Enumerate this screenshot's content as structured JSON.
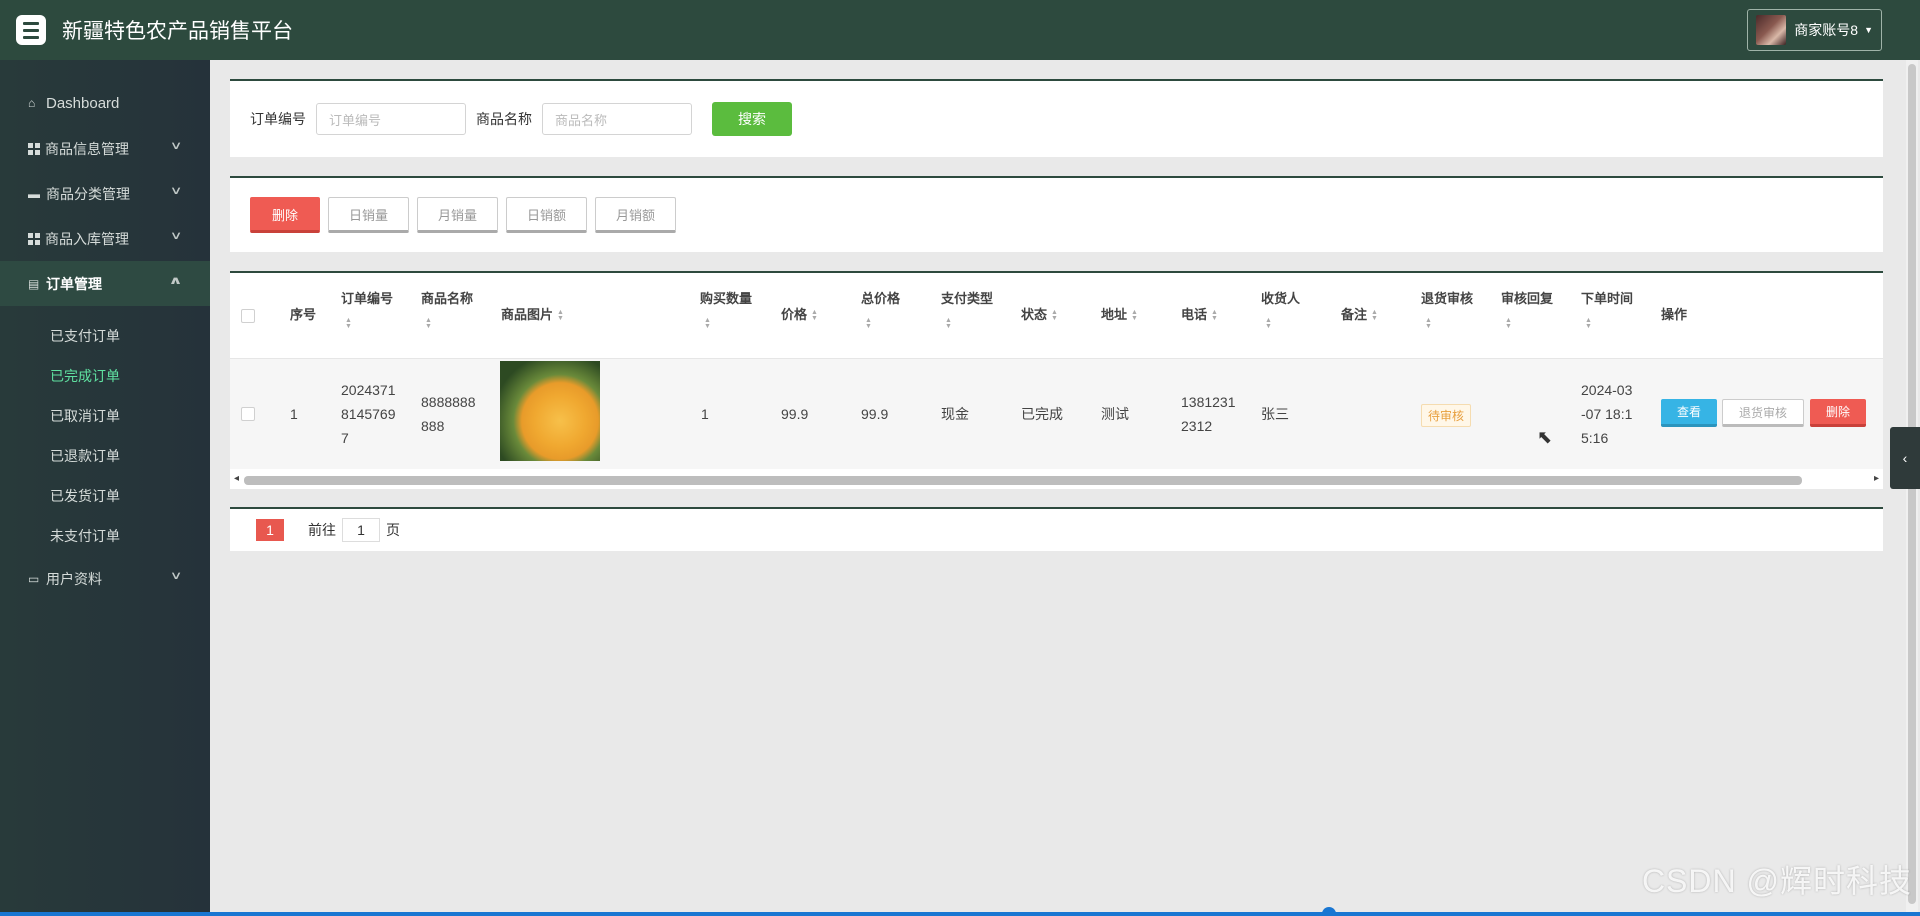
{
  "header": {
    "title": "新疆特色农产品销售平台",
    "account": "商家账号8"
  },
  "sidebar": {
    "items": [
      {
        "label": "Dashboard"
      },
      {
        "label": "商品信息管理"
      },
      {
        "label": "商品分类管理"
      },
      {
        "label": "商品入库管理"
      },
      {
        "label": "订单管理"
      },
      {
        "label": "用户资料"
      }
    ],
    "sub_items": [
      {
        "label": "已支付订单"
      },
      {
        "label": "已完成订单"
      },
      {
        "label": "已取消订单"
      },
      {
        "label": "已退款订单"
      },
      {
        "label": "已发货订单"
      },
      {
        "label": "未支付订单"
      }
    ]
  },
  "search": {
    "order_no_label": "订单编号",
    "order_no_placeholder": "订单编号",
    "product_name_label": "商品名称",
    "product_name_placeholder": "商品名称",
    "search_button": "搜索"
  },
  "actions": {
    "delete": "删除",
    "daily_sales_qty": "日销量",
    "monthly_sales_qty": "月销量",
    "daily_sales_amt": "日销额",
    "monthly_sales_amt": "月销额"
  },
  "table": {
    "headers": [
      "序号",
      "订单编号",
      "商品名称",
      "商品图片",
      "购买数量",
      "价格",
      "总价格",
      "支付类型",
      "状态",
      "地址",
      "电话",
      "收货人",
      "备注",
      "退货审核",
      "审核回复",
      "下单时间",
      "操作"
    ],
    "row": {
      "index": "1",
      "order_no_1": "2024371",
      "order_no_2": "8145769",
      "order_no_3": "7",
      "product_name_1": "8888888",
      "product_name_2": "888",
      "quantity": "1",
      "price": "99.9",
      "total": "99.9",
      "pay_type": "现金",
      "status": "已完成",
      "address": "测试",
      "phone_1": "1381231",
      "phone_2": "2312",
      "receiver": "张三",
      "note": "",
      "refund_review": "待审核",
      "review_reply": "",
      "order_time_1": "2024-03",
      "order_time_2": "-07 18:1",
      "order_time_3": "5:16",
      "btn_view": "查看",
      "btn_refund": "退货审核",
      "btn_delete": "删除"
    }
  },
  "pager": {
    "current": "1",
    "goto_label": "前往",
    "goto_value": "1",
    "page_suffix": "页"
  },
  "watermark": "CSDN @辉时科技"
}
